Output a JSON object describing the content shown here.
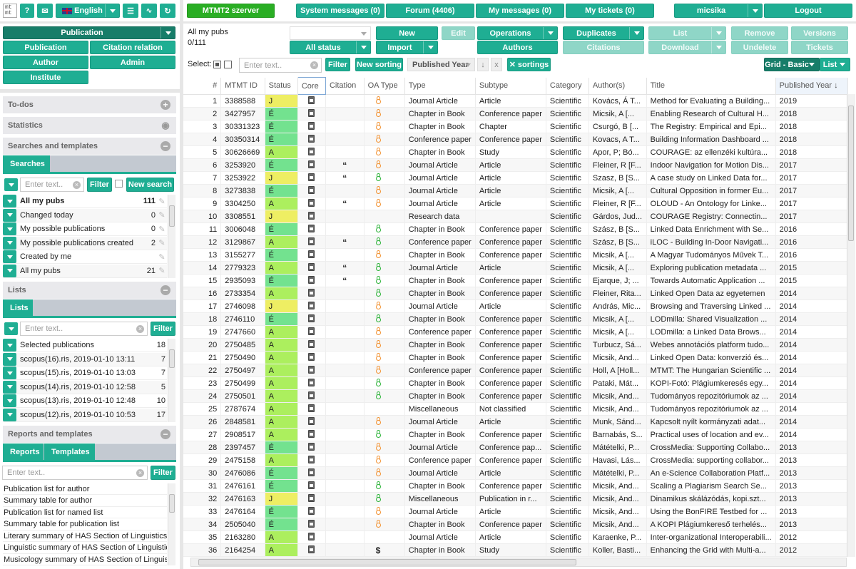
{
  "topbar": {
    "logo": "mt mt",
    "help_label": "?",
    "mail_icon": "mail-icon",
    "language": "English",
    "menu_icon": "hamburger-icon",
    "activity_icon": "pulse-icon",
    "refresh_icon": "refresh-icon"
  },
  "header": {
    "server": "MTMT2 szerver",
    "system_messages": "System messages (0)",
    "forum": "Forum (4406)",
    "my_messages": "My messages (0)",
    "my_tickets": "My tickets (0)",
    "user": "micsika",
    "logout": "Logout"
  },
  "nav": {
    "main": "Publication",
    "items": [
      "Publication",
      "Citation relation",
      "Author",
      "Admin",
      "Institute"
    ]
  },
  "sections": {
    "todos": "To-dos",
    "statistics": "Statistics",
    "searches_templates": "Searches and templates",
    "lists": "Lists",
    "reports_templates": "Reports and templates"
  },
  "searches": {
    "tab": "Searches",
    "placeholder": "Enter text..",
    "filter": "Filter",
    "new_search": "New search",
    "items": [
      {
        "label": "All my pubs",
        "count": "111",
        "bold": true
      },
      {
        "label": "Changed today",
        "count": "0"
      },
      {
        "label": "My possible publications",
        "count": "0"
      },
      {
        "label": "My possible publications created",
        "count": "2"
      },
      {
        "label": "Created by me",
        "count": ""
      },
      {
        "label": "All my pubs",
        "count": "21"
      }
    ]
  },
  "lists": {
    "tab": "Lists",
    "placeholder": "Enter text..",
    "filter": "Filter",
    "items": [
      {
        "label": "Selected publications",
        "count": "18"
      },
      {
        "label": "scopus(16).ris, 2019-01-10 13:11",
        "count": "7"
      },
      {
        "label": "scopus(15).ris, 2019-01-10 13:03",
        "count": "7"
      },
      {
        "label": "scopus(14).ris, 2019-01-10 12:58",
        "count": "5"
      },
      {
        "label": "scopus(13).ris, 2019-01-10 12:48",
        "count": "10"
      },
      {
        "label": "scopus(12).ris, 2019-01-10 10:53",
        "count": "17"
      }
    ]
  },
  "reports": {
    "tabs": [
      "Reports",
      "Templates"
    ],
    "placeholder": "Enter text..",
    "filter": "Filter",
    "items": [
      "Publication list for author",
      "Summary table for author",
      "Publication list for named list",
      "Summary table for publication list",
      "Literary summary of HAS Section of Linguistics and Literary Scholarship",
      "Linguistic summary of HAS Section of Linguistics and Literary Scholarship",
      "Musicology summary of HAS Section of Linguistics and Literary Scholarship"
    ]
  },
  "toolbar": {
    "title": "All my pubs",
    "count": "0/111",
    "status_filter": "All status",
    "new": "New",
    "edit": "Edit",
    "operations": "Operations",
    "duplicates": "Duplicates",
    "list": "List",
    "remove": "Remove",
    "versions": "Versions",
    "import": "Import",
    "authors": "Authors",
    "citations": "Citations",
    "download": "Download",
    "undelete": "Undelete",
    "tickets": "Tickets",
    "select_label": "Select:",
    "filter_placeholder": "Enter text..",
    "filter": "Filter",
    "new_sorting": "New sorting",
    "sort_field": "Published Year",
    "sort_dir": "↓",
    "sort_clear": "x",
    "sortings": "sortings",
    "view_grid": "Grid - Basic",
    "view_list": "List"
  },
  "table": {
    "columns": [
      "#",
      "MTMT ID",
      "Status",
      "Core",
      "Citation",
      "OA Type",
      "Type",
      "Subtype",
      "Category",
      "Author(s)",
      "Title",
      "Published Year ↓"
    ],
    "rows": [
      [
        "1",
        "3388588",
        "J",
        "doc",
        "",
        "orange",
        "Journal Article",
        "Article",
        "Scientific",
        "Kovács, Á T...",
        "Method for Evaluating a Building...",
        "2019"
      ],
      [
        "2",
        "3427957",
        "É",
        "doc",
        "",
        "orange",
        "Chapter in Book",
        "Conference paper",
        "Scientific",
        "Micsik, A [...",
        "Enabling Research of Cultural H...",
        "2018"
      ],
      [
        "3",
        "30331323",
        "É",
        "doc",
        "",
        "orange",
        "Chapter in Book",
        "Chapter",
        "Scientific",
        "Csurgó, B [...",
        "The Registry: Empirical and Epi...",
        "2018"
      ],
      [
        "4",
        "30350314",
        "É",
        "doc",
        "",
        "orange",
        "Conference paper",
        "Conference paper",
        "Scientific",
        "Kovacs, A T...",
        "Building Information Dashboard ...",
        "2018"
      ],
      [
        "5",
        "30626669",
        "A",
        "doc",
        "",
        "orange",
        "Chapter in Book",
        "Study",
        "Scientific",
        "Apor, P; Bó...",
        "COURAGE: az ellenzéki kultúra...",
        "2018"
      ],
      [
        "6",
        "3253920",
        "É",
        "doc",
        "cite",
        "orange",
        "Journal Article",
        "Article",
        "Scientific",
        "Fleiner, R [F...",
        "Indoor Navigation for Motion Dis...",
        "2017"
      ],
      [
        "7",
        "3253922",
        "J",
        "doc",
        "cite",
        "green",
        "Journal Article",
        "Article",
        "Scientific",
        "Szasz, B [S...",
        "A case study on Linked Data for...",
        "2017"
      ],
      [
        "8",
        "3273838",
        "É",
        "doc",
        "",
        "orange",
        "Journal Article",
        "Article",
        "Scientific",
        "Micsik, A [...",
        "Cultural Opposition in former Eu...",
        "2017"
      ],
      [
        "9",
        "3304250",
        "A",
        "doc",
        "cite",
        "orange",
        "Journal Article",
        "Article",
        "Scientific",
        "Fleiner, R [F...",
        "OLOUD - An Ontology for Linke...",
        "2017"
      ],
      [
        "10",
        "3308551",
        "J",
        "doc",
        "",
        "",
        "Research data",
        "",
        "Scientific",
        "Gárdos, Jud...",
        "COURAGE Registry: Connectin...",
        "2017"
      ],
      [
        "11",
        "3006048",
        "É",
        "doc",
        "",
        "green",
        "Chapter in Book",
        "Conference paper",
        "Scientific",
        "Szász, B [S...",
        "Linked Data Enrichment with Se...",
        "2016"
      ],
      [
        "12",
        "3129867",
        "A",
        "doc",
        "cite",
        "green",
        "Conference paper",
        "Conference paper",
        "Scientific",
        "Szász, B [S...",
        "iLOC - Building In-Door Navigati...",
        "2016"
      ],
      [
        "13",
        "3155277",
        "É",
        "doc",
        "",
        "orange",
        "Chapter in Book",
        "Conference paper",
        "Scientific",
        "Micsik, A [...",
        "A Magyar Tudományos Művek T...",
        "2016"
      ],
      [
        "14",
        "2779323",
        "A",
        "doc",
        "cite",
        "green",
        "Journal Article",
        "Article",
        "Scientific",
        "Micsik, A [...",
        "Exploring publication metadata ...",
        "2015"
      ],
      [
        "15",
        "2935093",
        "É",
        "doc",
        "cite",
        "green",
        "Chapter in Book",
        "Conference paper",
        "Scientific",
        "Ejarque, J; ...",
        "Towards Automatic Application ...",
        "2015"
      ],
      [
        "16",
        "2733354",
        "A",
        "doc",
        "",
        "green",
        "Chapter in Book",
        "Conference paper",
        "Scientific",
        "Fleiner, Rita...",
        "Linked Open Data az egyetemen",
        "2014"
      ],
      [
        "17",
        "2746098",
        "J",
        "doc",
        "",
        "orange",
        "Journal Article",
        "Article",
        "Scientific",
        "András, Mic...",
        "Browsing and Traversing Linked ...",
        "2014"
      ],
      [
        "18",
        "2746110",
        "É",
        "doc",
        "",
        "green",
        "Chapter in Book",
        "Conference paper",
        "Scientific",
        "Micsik, A [...",
        "LODmilla: Shared Visualization ...",
        "2014"
      ],
      [
        "19",
        "2747660",
        "A",
        "doc",
        "",
        "orange",
        "Conference paper",
        "Conference paper",
        "Scientific",
        "Micsik, A [...",
        "LODmilla: a Linked Data Brows...",
        "2014"
      ],
      [
        "20",
        "2750485",
        "A",
        "doc",
        "",
        "orange",
        "Chapter in Book",
        "Conference paper",
        "Scientific",
        "Turbucz, Sá...",
        "Webes annotációs platform tudo...",
        "2014"
      ],
      [
        "21",
        "2750490",
        "A",
        "doc",
        "",
        "orange",
        "Chapter in Book",
        "Conference paper",
        "Scientific",
        "Micsik, And...",
        "Linked Open Data: konverzió és...",
        "2014"
      ],
      [
        "22",
        "2750497",
        "A",
        "doc",
        "",
        "orange",
        "Conference paper",
        "Conference paper",
        "Scientific",
        "Holl, A [Holl...",
        "MTMT: The Hungarian Scientific ...",
        "2014"
      ],
      [
        "23",
        "2750499",
        "A",
        "doc",
        "",
        "green",
        "Chapter in Book",
        "Conference paper",
        "Scientific",
        "Pataki, Mát...",
        "KOPI-Fotó: Plágiumkeresés egy...",
        "2014"
      ],
      [
        "24",
        "2750501",
        "A",
        "doc",
        "",
        "green",
        "Chapter in Book",
        "Conference paper",
        "Scientific",
        "Micsik, And...",
        "Tudományos repozitóriumok az ...",
        "2014"
      ],
      [
        "25",
        "2787674",
        "A",
        "doc",
        "",
        "",
        "Miscellaneous",
        "Not classified",
        "Scientific",
        "Micsik, And...",
        "Tudományos repozitóriumok az ...",
        "2014"
      ],
      [
        "26",
        "2848581",
        "A",
        "doc",
        "",
        "orange",
        "Journal Article",
        "Article",
        "Scientific",
        "Munk, Sánd...",
        "Kapcsolt nyílt kormányzati adat...",
        "2014"
      ],
      [
        "27",
        "2908517",
        "A",
        "doc",
        "",
        "green",
        "Chapter in Book",
        "Conference paper",
        "Scientific",
        "Barnabás, S...",
        "Practical uses of location and ev...",
        "2014"
      ],
      [
        "28",
        "2397457",
        "É",
        "doc",
        "",
        "orange",
        "Journal Article",
        "Conference pap...",
        "Scientific",
        "Mátételki, P...",
        "CrossMedia: Supporting Collabo...",
        "2013"
      ],
      [
        "29",
        "2475158",
        "A",
        "doc",
        "",
        "orange",
        "Conference paper",
        "Conference paper",
        "Scientific",
        "Havasi, Lás...",
        "CrossMedia: supporting collabor...",
        "2013"
      ],
      [
        "30",
        "2476086",
        "É",
        "doc",
        "",
        "orange",
        "Journal Article",
        "Article",
        "Scientific",
        "Mátételki, P...",
        "An e-Science Collaboration Platf...",
        "2013"
      ],
      [
        "31",
        "2476161",
        "É",
        "doc",
        "",
        "green",
        "Chapter in Book",
        "Conference paper",
        "Scientific",
        "Micsik, And...",
        "Scaling a Plagiarism Search Se...",
        "2013"
      ],
      [
        "32",
        "2476163",
        "J",
        "doc",
        "",
        "green",
        "Miscellaneous",
        "Publication in r...",
        "Scientific",
        "Micsik, And...",
        "Dinamikus skálázódás, kopi.szt...",
        "2013"
      ],
      [
        "33",
        "2476164",
        "É",
        "doc",
        "",
        "orange",
        "Journal Article",
        "Article",
        "Scientific",
        "Micsik, And...",
        "Using the BonFIRE Testbed for ...",
        "2013"
      ],
      [
        "34",
        "2505040",
        "É",
        "doc",
        "",
        "orange",
        "Chapter in Book",
        "Conference paper",
        "Scientific",
        "Micsik, And...",
        "A KOPI Plágiumkereső terhelés...",
        "2013"
      ],
      [
        "35",
        "2163280",
        "A",
        "doc",
        "",
        "",
        "Journal Article",
        "Article",
        "Scientific",
        "Karaenke, P...",
        "Inter-organizational Interoperabili...",
        "2012"
      ],
      [
        "36",
        "2164254",
        "A",
        "doc",
        "",
        "dollar",
        "Chapter in Book",
        "Study",
        "Scientific",
        "Koller, Basti...",
        "Enhancing the Grid with Multi-a...",
        "2012"
      ]
    ]
  },
  "colors": {
    "accent": "#1fae93",
    "accent_dark": "#177d69",
    "server_green": "#2aae24",
    "status_J": "#eeee63",
    "status_E": "#73e28f",
    "status_A": "#acef5e",
    "oa_orange": "#f29232",
    "oa_green": "#2cb238"
  }
}
